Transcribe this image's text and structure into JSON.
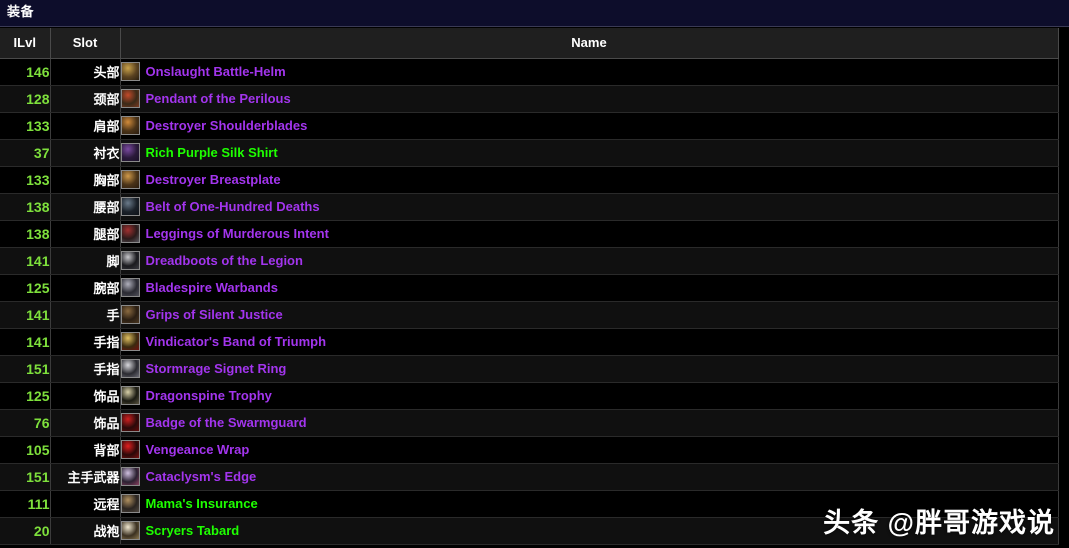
{
  "window": {
    "title": "装备"
  },
  "table": {
    "columns": [
      {
        "key": "ilvl",
        "label": "ILvl"
      },
      {
        "key": "slot",
        "label": "Slot"
      },
      {
        "key": "name",
        "label": "Name"
      }
    ],
    "rows": [
      {
        "ilvl": "146",
        "slot": "头部",
        "name": "Onslaught Battle-Helm",
        "quality": "epic",
        "icon": "helm-icon",
        "icon_colors": [
          "#5a4220",
          "#c9a24a",
          "#2a1f10"
        ]
      },
      {
        "ilvl": "128",
        "slot": "颈部",
        "name": "Pendant of the Perilous",
        "quality": "epic",
        "icon": "necklace-icon",
        "icon_colors": [
          "#3a2a18",
          "#c24a2a",
          "#7a3a20"
        ]
      },
      {
        "ilvl": "133",
        "slot": "肩部",
        "name": "Destroyer Shoulderblades",
        "quality": "epic",
        "icon": "shoulder-icon",
        "icon_colors": [
          "#4a3318",
          "#d08a3a",
          "#2a1c0e"
        ]
      },
      {
        "ilvl": "37",
        "slot": "衬衣",
        "name": "Rich Purple Silk Shirt",
        "quality": "uncommon",
        "icon": "shirt-icon",
        "icon_colors": [
          "#2a1a3a",
          "#7a4aa0",
          "#1a1028"
        ]
      },
      {
        "ilvl": "133",
        "slot": "胸部",
        "name": "Destroyer Breastplate",
        "quality": "epic",
        "icon": "chest-icon",
        "icon_colors": [
          "#4a3318",
          "#d09a4a",
          "#2a1c0e"
        ]
      },
      {
        "ilvl": "138",
        "slot": "腰部",
        "name": "Belt of One-Hundred Deaths",
        "quality": "epic",
        "icon": "belt-icon",
        "icon_colors": [
          "#1a2028",
          "#6a7a8a",
          "#0e1218"
        ]
      },
      {
        "ilvl": "138",
        "slot": "腿部",
        "name": "Leggings of Murderous Intent",
        "quality": "epic",
        "icon": "legs-icon",
        "icon_colors": [
          "#2a1a1a",
          "#a03030",
          "#58585f"
        ]
      },
      {
        "ilvl": "141",
        "slot": "脚",
        "name": "Dreadboots of the Legion",
        "quality": "epic",
        "icon": "boots-icon",
        "icon_colors": [
          "#1a1a1e",
          "#c8c8cc",
          "#3a3a40"
        ]
      },
      {
        "ilvl": "125",
        "slot": "腕部",
        "name": "Bladespire Warbands",
        "quality": "epic",
        "icon": "bracer-icon",
        "icon_colors": [
          "#2a2a32",
          "#b0b0bc",
          "#50505a"
        ]
      },
      {
        "ilvl": "141",
        "slot": "手",
        "name": "Grips of Silent Justice",
        "quality": "epic",
        "icon": "gloves-icon",
        "icon_colors": [
          "#2a1e12",
          "#8a6a40",
          "#4a3620"
        ]
      },
      {
        "ilvl": "141",
        "slot": "手指",
        "name": "Vindicator's Band of Triumph",
        "quality": "epic",
        "icon": "ring-icon",
        "icon_colors": [
          "#3a2a10",
          "#e0c060",
          "#701010"
        ]
      },
      {
        "ilvl": "151",
        "slot": "手指",
        "name": "Stormrage Signet Ring",
        "quality": "epic",
        "icon": "ring-icon",
        "icon_colors": [
          "#2a2a30",
          "#d8d8dc",
          "#6a6a74"
        ]
      },
      {
        "ilvl": "125",
        "slot": "饰品",
        "name": "Dragonspine Trophy",
        "quality": "epic",
        "icon": "trinket-icon",
        "icon_colors": [
          "#1a1a12",
          "#d8d0a8",
          "#5a5440"
        ]
      },
      {
        "ilvl": "76",
        "slot": "饰品",
        "name": "Badge of the Swarmguard",
        "quality": "epic",
        "icon": "trinket-icon",
        "icon_colors": [
          "#2a0a0a",
          "#d02020",
          "#600808"
        ]
      },
      {
        "ilvl": "105",
        "slot": "背部",
        "name": "Vengeance Wrap",
        "quality": "epic",
        "icon": "cloak-icon",
        "icon_colors": [
          "#2a0808",
          "#e02020",
          "#7a1010"
        ]
      },
      {
        "ilvl": "151",
        "slot": "主手武器",
        "name": "Cataclysm's Edge",
        "quality": "epic",
        "icon": "sword-icon",
        "icon_colors": [
          "#2a2030",
          "#d0c0e0",
          "#8a4060"
        ]
      },
      {
        "ilvl": "111",
        "slot": "远程",
        "name": "Mama's Insurance",
        "quality": "uncommon",
        "icon": "gun-icon",
        "icon_colors": [
          "#2a2420",
          "#b09060",
          "#504840"
        ]
      },
      {
        "ilvl": "20",
        "slot": "战袍",
        "name": "Scryers Tabard",
        "quality": "uncommon",
        "icon": "tabard-icon",
        "icon_colors": [
          "#3a3020",
          "#f0e8d0",
          "#8a7850"
        ]
      }
    ]
  },
  "watermark": {
    "text": "头条 @胖哥游戏说"
  },
  "colors": {
    "quality_epic": "#a335ee",
    "quality_uncommon": "#1eff00",
    "ilvl_text": "#7ee03c",
    "titlebar_bg": "#0d0d2b",
    "header_bg": "#1f1f1f"
  }
}
